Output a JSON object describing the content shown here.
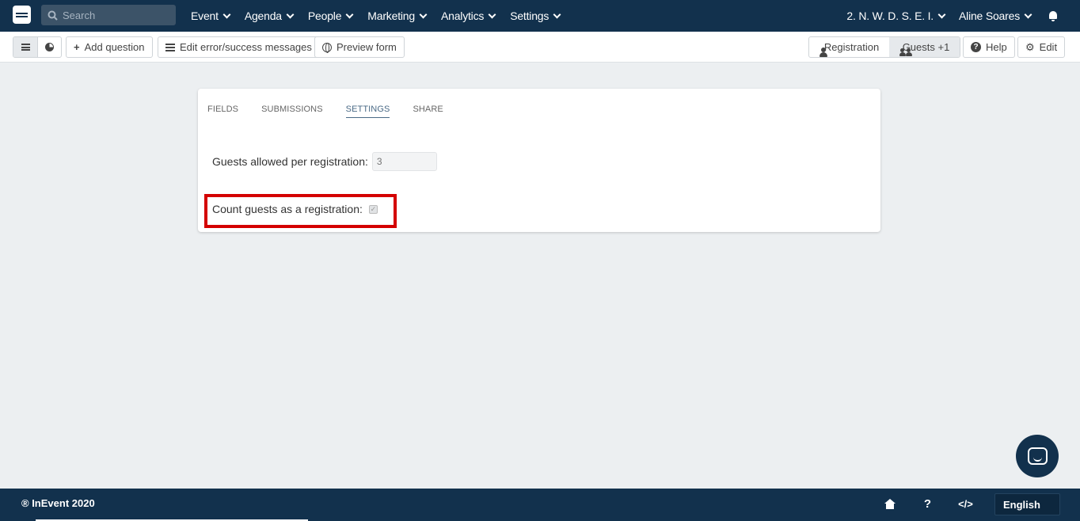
{
  "nav": {
    "search_placeholder": "Search",
    "menu": [
      "Event",
      "Agenda",
      "People",
      "Marketing",
      "Analytics",
      "Settings"
    ],
    "event_name": "2. N. W. D. S. E. I.",
    "user_name": "Aline Soares"
  },
  "toolbar": {
    "add_question": "Add question",
    "edit_messages": "Edit error/success messages",
    "preview_form": "Preview form",
    "registration": "Registration",
    "guests": "Guests +1",
    "help": "Help",
    "edit": "Edit"
  },
  "card": {
    "tabs": [
      "FIELDS",
      "SUBMISSIONS",
      "SETTINGS",
      "SHARE"
    ],
    "active_tab": "SETTINGS",
    "guests_allowed_label": "Guests allowed per registration:",
    "guests_allowed_value": "3",
    "count_guests_label": "Count guests as a registration:",
    "count_guests_checked": true
  },
  "footer": {
    "copyright": "® InEvent 2020",
    "language": "English"
  },
  "colors": {
    "nav_bg": "#12314d",
    "highlight": "#d40000",
    "page_bg": "#eceff1"
  }
}
